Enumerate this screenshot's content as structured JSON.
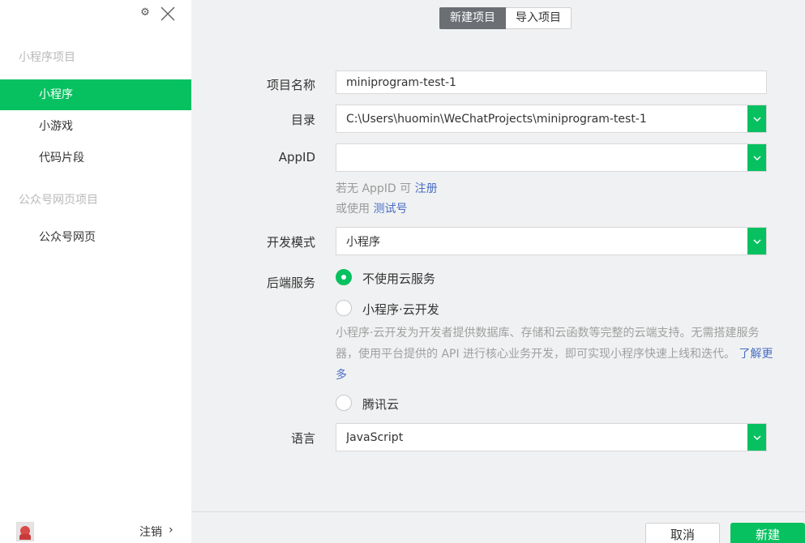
{
  "sidebar": {
    "icons": {
      "settings": "gear-icon",
      "close": "close-icon"
    },
    "sections": [
      {
        "title": "小程序项目",
        "items": [
          "小程序",
          "小游戏",
          "代码片段"
        ]
      },
      {
        "title": "公众号网页项目",
        "items": [
          "公众号网页"
        ]
      }
    ],
    "active_item": "小程序",
    "logout_label": "注销",
    "logout_arrow": "›"
  },
  "tabs": {
    "new_project": "新建项目",
    "import_project": "导入项目"
  },
  "form": {
    "name_label": "项目名称",
    "name_value": "miniprogram-test-1",
    "dir_label": "目录",
    "dir_value": "C:\\Users\\huomin\\WeChatProjects\\miniprogram-test-1",
    "appid_label": "AppID",
    "appid_value": "",
    "appid_hint_prefix": "若无 AppID 可",
    "appid_hint_link": "注册",
    "appid_hint2_prefix": "或使用",
    "appid_hint2_link": "测试号",
    "mode_label": "开发模式",
    "mode_value": "小程序",
    "backend_label": "后端服务",
    "backend_options": [
      "不使用云服务",
      "小程序·云开发",
      "腾讯云"
    ],
    "backend_selected": "不使用云服务",
    "cloud_desc": "小程序·云开发为开发者提供数据库、存储和云函数等完整的云端支持。无需搭建服务器，使用平台提供的 API 进行核心业务开发，即可实现小程序快速上线和迭代。",
    "cloud_desc_link": "了解更多",
    "lang_label": "语言",
    "lang_value": "JavaScript"
  },
  "footer": {
    "cancel_label": "取消",
    "create_label": "新建"
  },
  "colors": {
    "accent": "#07c160",
    "sidebar_bg": "#ffffff",
    "main_bg": "#f0f1f2",
    "tab_active": "#6b6e73"
  }
}
